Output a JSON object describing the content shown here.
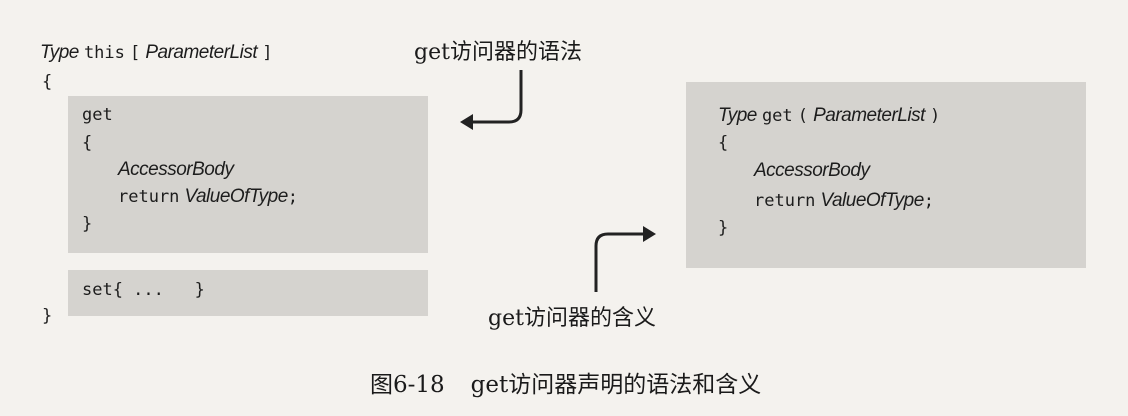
{
  "left": {
    "header": {
      "type": "Type",
      "this": "this",
      "lbracket": "[",
      "param": "ParameterList",
      "rbracket": "]"
    },
    "open_brace": "{",
    "close_brace": "}",
    "get_box": {
      "get": "get",
      "open": "{",
      "body": "AccessorBody",
      "return_kw": "return",
      "value": "ValueOfType",
      "semi": ";",
      "close": "}"
    },
    "set_box": {
      "text": "set{ ...   }"
    }
  },
  "right": {
    "type": "Type",
    "get": "get",
    "lparen": "(",
    "param": "ParameterList",
    "rparen": ")",
    "open": "{",
    "body": "AccessorBody",
    "return_kw": "return",
    "value": "ValueOfType",
    "semi": ";",
    "close": "}"
  },
  "labels": {
    "syntax": "get访问器的语法",
    "meaning": "get访问器的含义"
  },
  "caption": {
    "number": "图6-18",
    "text": "get访问器声明的语法和含义"
  }
}
